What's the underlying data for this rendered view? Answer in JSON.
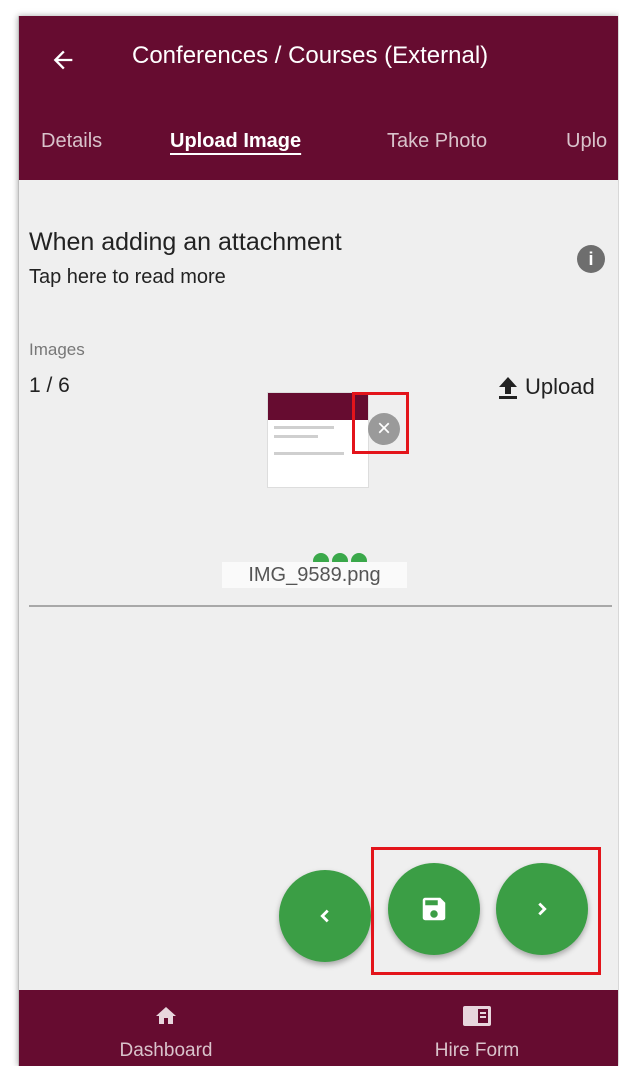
{
  "header": {
    "title": "Conferences / Courses (External)",
    "back_icon": "arrow-left-icon"
  },
  "tabs": [
    {
      "label": "Details",
      "active": false
    },
    {
      "label": "Upload Image",
      "active": true
    },
    {
      "label": "Take Photo",
      "active": false
    },
    {
      "label": "Uplo",
      "active": false
    }
  ],
  "info": {
    "heading": "When adding an attachment",
    "subtext": "Tap here to read more",
    "icon": "info-icon"
  },
  "images": {
    "label": "Images",
    "count": "1 / 6",
    "upload_label": "Upload",
    "upload_icon": "upload-icon",
    "attachment": {
      "filename": "IMG_9589.png",
      "remove_icon": "close-icon"
    }
  },
  "actions": {
    "prev_icon": "chevron-left-icon",
    "save_icon": "save-icon",
    "next_icon": "chevron-right-icon"
  },
  "bottom_nav": [
    {
      "label": "Dashboard",
      "icon": "home-icon"
    },
    {
      "label": "Hire Form",
      "icon": "form-icon"
    }
  ],
  "colors": {
    "brand": "#660c30",
    "fab": "#3b9e45",
    "highlight": "#e3141b"
  }
}
